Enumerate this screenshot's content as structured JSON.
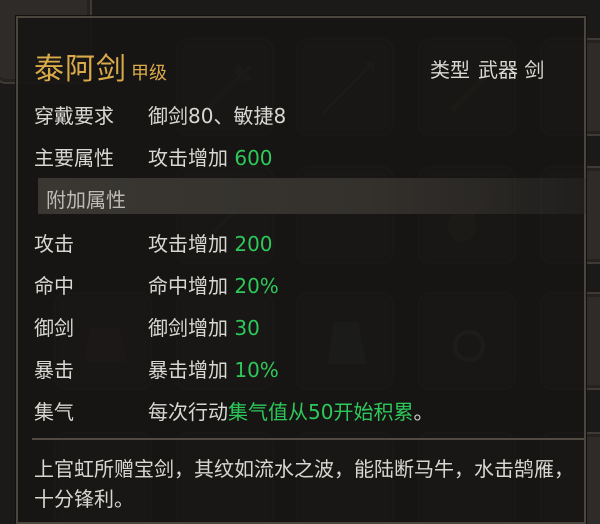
{
  "item": {
    "name": "泰阿剑",
    "grade": "甲级",
    "type_label": "类型",
    "type_value": "武器 剑"
  },
  "requirements": {
    "label": "穿戴要求",
    "value": "御剑80、敏捷8"
  },
  "main_attribute": {
    "label": "主要属性",
    "prefix": "攻击增加 ",
    "value": "600"
  },
  "extra_section_title": "附加属性",
  "extra_attributes": [
    {
      "label": "攻击",
      "prefix": "攻击增加 ",
      "value": "200"
    },
    {
      "label": "命中",
      "prefix": "命中增加 ",
      "value": "20%"
    },
    {
      "label": "御剑",
      "prefix": "御剑增加 ",
      "value": "30"
    },
    {
      "label": "暴击",
      "prefix": "暴击增加 ",
      "value": "10%"
    }
  ],
  "special": {
    "label": "集气",
    "prefix": "每次行动",
    "highlight": "集气值从50开始积累",
    "suffix": "。"
  },
  "description": "上官虹所赠宝剑，其纹如流水之波，能陆断马牛，水击鹄雁，十分锋利。",
  "colors": {
    "title": "#d9a94a",
    "highlight": "#2ec85a",
    "text": "#d8d8d2"
  },
  "background_icons": [
    "halberd-icon",
    "spear-icon",
    "flute-icon",
    "pipa-icon",
    "sword-icon",
    "armor-icon",
    "ring-icon"
  ]
}
